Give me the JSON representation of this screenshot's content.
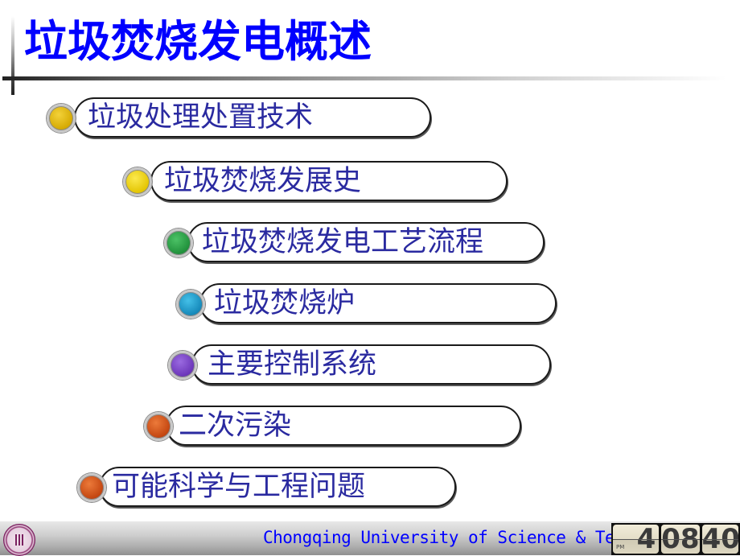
{
  "slide": {
    "title": "垃圾焚烧发电概述",
    "items": [
      {
        "label": "垃圾处理处置技术",
        "bullet_color": "#d4a800",
        "bullet_highlight": "#f3d23a"
      },
      {
        "label": "垃圾焚烧发展史",
        "bullet_color": "#e3c400",
        "bullet_highlight": "#fbe94d"
      },
      {
        "label": "垃圾焚烧发电工艺流程",
        "bullet_color": "#1f8f3a",
        "bullet_highlight": "#4cc266"
      },
      {
        "label": "垃圾焚烧炉",
        "bullet_color": "#1487b8",
        "bullet_highlight": "#44c0e8"
      },
      {
        "label": "主要控制系统",
        "bullet_color": "#6a34b8",
        "bullet_highlight": "#9a6ae0"
      },
      {
        "label": "二次污染",
        "bullet_color": "#c2440f",
        "bullet_highlight": "#ec7a3a"
      },
      {
        "label": "可能科学与工程问题",
        "bullet_color": "#c2440f",
        "bullet_highlight": "#ec7a3a"
      }
    ]
  },
  "footer": {
    "logo": "university-seal-logo",
    "text": "Chongqing University of Science & Tech",
    "clock": {
      "ampm": "PM",
      "hour": "4",
      "minute": "08",
      "second": "40"
    }
  },
  "colors": {
    "title": "#0000ff",
    "item_text": "#2a2aa0",
    "footer_text": "#0000ff"
  }
}
